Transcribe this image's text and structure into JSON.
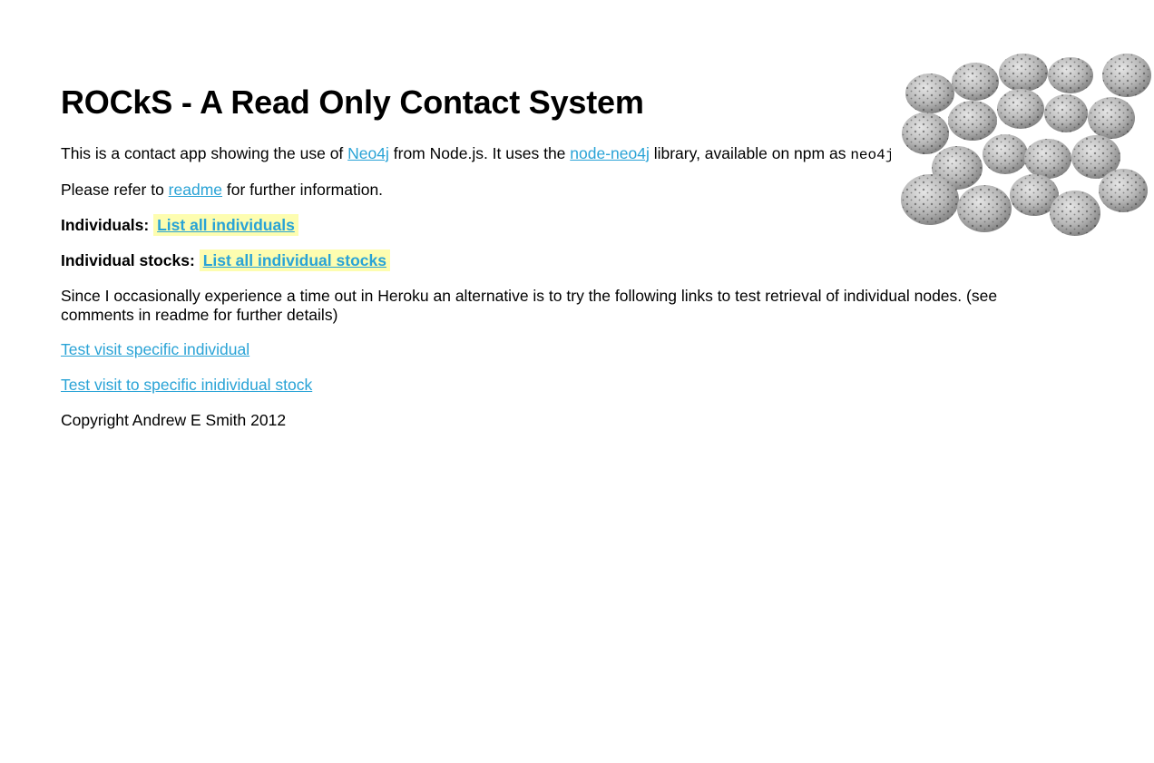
{
  "page": {
    "title": "ROCkS - A Read Only Contact System"
  },
  "intro": {
    "text1": "This is a contact app showing the use of ",
    "link_neo4j": "Neo4j",
    "text2": " from Node.js. It uses the ",
    "link_node_neo4j": "node-neo4j",
    "text3": " library, available on npm as ",
    "npm_name": "neo4j"
  },
  "readme_line": {
    "text1": "Please refer to ",
    "link": "readme",
    "text2": " for further information."
  },
  "individuals": {
    "label": "Individuals:",
    "link": "List all individuals"
  },
  "stocks": {
    "label": "Individual stocks:",
    "link": "List all individual stocks"
  },
  "note": {
    "text": "Since I occasionally experience a time out in Heroku an alternative is to try the following links to test retrieval of individual nodes. (see comments in readme for further details)"
  },
  "test_links": {
    "individual": "Test visit specific individual",
    "stock": "Test visit to specific inidividual stock"
  },
  "footer": {
    "copyright": "Copyright Andrew E Smith 2012"
  },
  "colors": {
    "link": "#29a3d6",
    "highlight": "#fdfdb0",
    "text": "#000000",
    "background": "#ffffff"
  },
  "image": {
    "icon": "rocks-image"
  }
}
